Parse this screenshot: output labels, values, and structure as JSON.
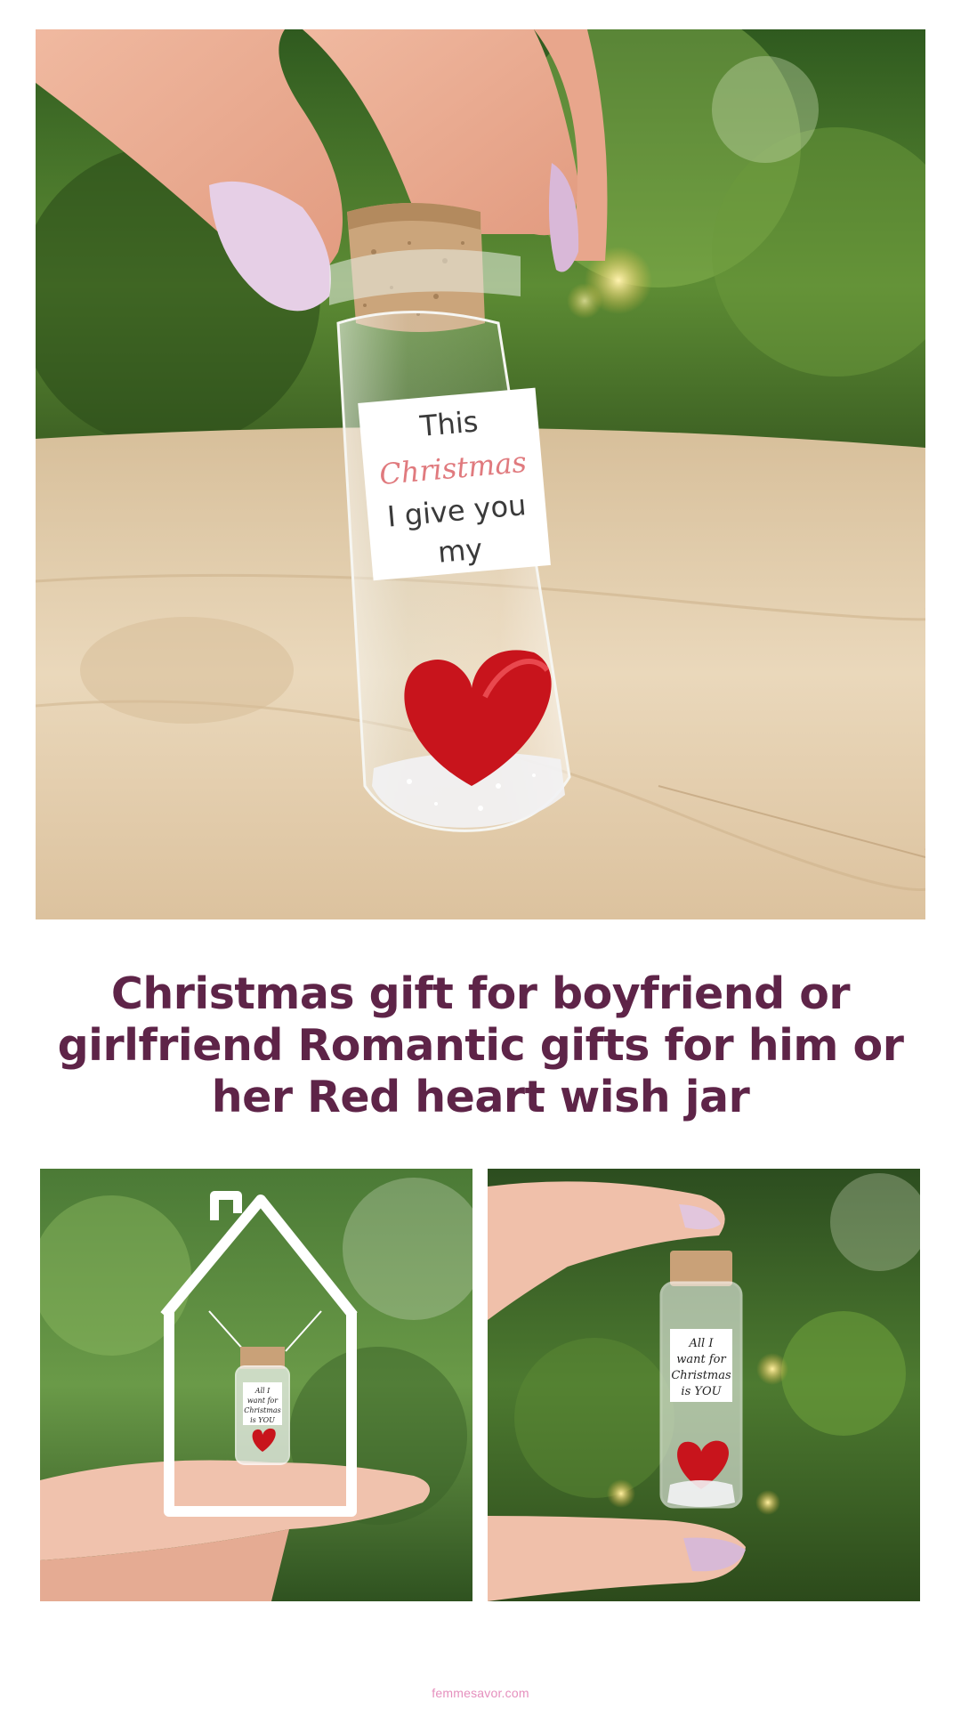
{
  "hero": {
    "label_lines": [
      "This",
      "Christmas",
      "I give you",
      "my"
    ],
    "colors": {
      "label_text": "#3a3a3a",
      "label_accent": "#e07a7e",
      "heart": "#c8141c",
      "cork": "#c9a178",
      "table": "#e3cfae",
      "foliage": "#4f7d2e"
    }
  },
  "title": {
    "text": "Christmas gift for boyfriend or girlfriend Romantic gifts for him or her Red heart wish jar",
    "color": "#5e2448"
  },
  "photo_left": {
    "label_lines": [
      "All I",
      "want for",
      "Christmas",
      "is YOU"
    ]
  },
  "photo_right": {
    "label_lines": [
      "All I",
      "want for",
      "Christmas",
      "is YOU"
    ]
  },
  "watermark": {
    "text": "femmesavor.com",
    "color": "#e58fbd"
  }
}
